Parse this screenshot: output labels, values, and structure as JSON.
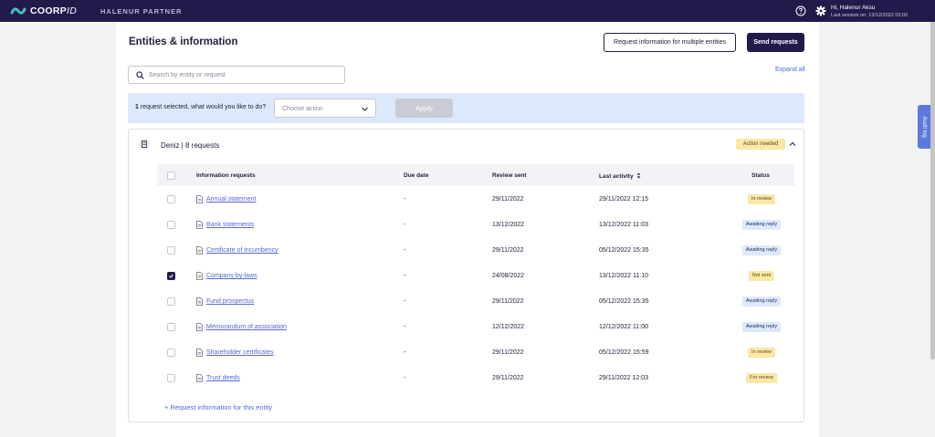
{
  "topbar": {
    "logo_text": "COORP",
    "logo_suffix": "ID",
    "partner": "HALENUR PARTNER",
    "user_greeting": "Hi, Halenur Aksu",
    "last_session": "Last session on: 13/12/2022 03:02"
  },
  "header": {
    "title": "Entities & information",
    "request_multiple_label": "Request information for multiple entities",
    "send_requests_label": "Send requests"
  },
  "search": {
    "placeholder": "Search by entity or request"
  },
  "expand_all": "Expand all",
  "action_bar": {
    "count": "1",
    "text": " request selected, what would you like to do?",
    "select_placeholder": "Choose action",
    "apply_label": "Apply"
  },
  "entity": {
    "title": "Deniz | 8 requests",
    "badge": "Action needed",
    "columns": {
      "info": "Information requests",
      "due": "Due date",
      "review": "Review sent",
      "activity": "Last activity",
      "status": "Status"
    },
    "rows": [
      {
        "name": "Annual statement",
        "due": "-",
        "review": "29/11/2022",
        "activity": "29/11/2022 12:15",
        "status": "In review",
        "color": "yellow",
        "checked": false
      },
      {
        "name": "Bank statements",
        "due": "-",
        "review": "13/12/2022",
        "activity": "13/12/2022 11:03",
        "status": "Awaiting reply",
        "color": "blue",
        "checked": false
      },
      {
        "name": "Certificate of incumbency",
        "due": "-",
        "review": "29/11/2022",
        "activity": "05/12/2022 15:35",
        "status": "Awaiting reply",
        "color": "blue",
        "checked": false
      },
      {
        "name": "Company by-laws",
        "due": "-",
        "review": "24/08/2022",
        "activity": "13/12/2022 11:10",
        "status": "Not sent",
        "color": "yellow",
        "checked": true
      },
      {
        "name": "Fund prospectus",
        "due": "-",
        "review": "29/11/2022",
        "activity": "05/12/2022 15:35",
        "status": "Awaiting reply",
        "color": "blue",
        "checked": false
      },
      {
        "name": "Memorandum of association",
        "due": "-",
        "review": "12/12/2022",
        "activity": "12/12/2022 11:00",
        "status": "Awaiting reply",
        "color": "blue",
        "checked": false
      },
      {
        "name": "Shareholder certificates",
        "due": "-",
        "review": "29/11/2022",
        "activity": "05/12/2022 15:59",
        "status": "In review",
        "color": "yellow",
        "checked": false
      },
      {
        "name": "Trust deeds",
        "due": "-",
        "review": "29/11/2022",
        "activity": "29/11/2022 12:03",
        "status": "For review",
        "color": "yellow",
        "checked": false
      }
    ],
    "add_request": "+ Request information for this entity"
  },
  "audit_log": "Audit log",
  "colors": {
    "brand": "#231a4c",
    "link": "#4f6ad6",
    "action_bg": "#dce9fb",
    "badge_yellow": "#fbe7a8"
  }
}
